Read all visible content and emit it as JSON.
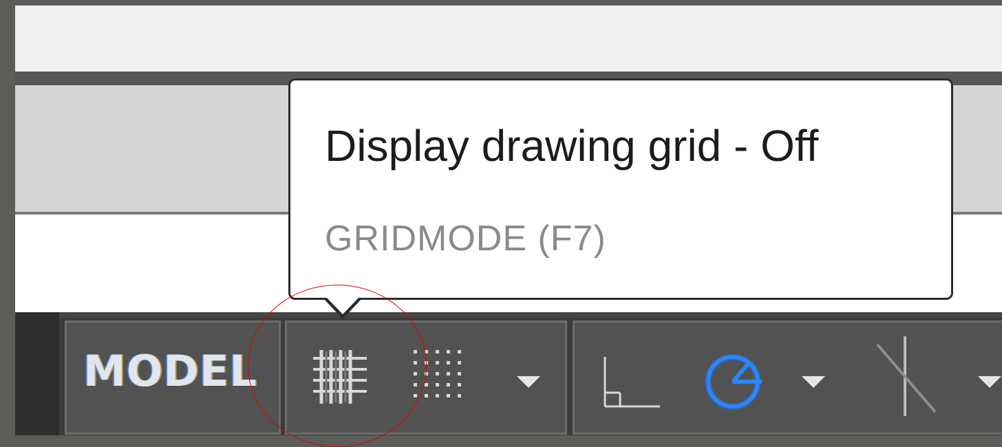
{
  "statusbar": {
    "model_label": "MODEL",
    "icons": {
      "grid": "grid-display-icon",
      "snap": "snap-mode-icon",
      "grid_dropdown": "chevron-down-icon",
      "ortho": "ortho-mode-icon",
      "polar": "polar-tracking-icon",
      "polar_dropdown": "chevron-down-icon",
      "isodraft": "isometric-drafting-icon",
      "iso_dropdown": "chevron-down-icon"
    },
    "polar_active": true
  },
  "tooltip": {
    "title": "Display drawing grid - Off",
    "command": "GRIDMODE (F7)"
  },
  "colors": {
    "status_bg": "#3c3c3c",
    "group_bg": "#525252",
    "active_accent": "#1e7df0",
    "highlight": "#e00000"
  }
}
